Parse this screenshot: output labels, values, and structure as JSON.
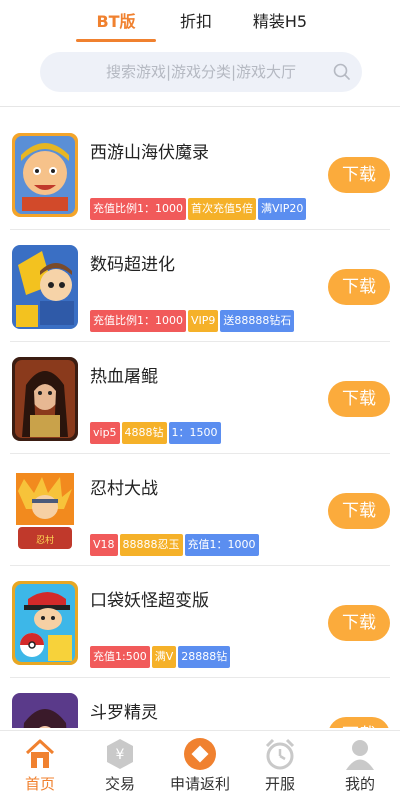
{
  "top_tabs": [
    {
      "label": "BT版",
      "active": true
    },
    {
      "label": "折扣",
      "active": false
    },
    {
      "label": "精装H5",
      "active": false
    }
  ],
  "search": {
    "placeholder": "搜索游戏|游戏分类|游戏大厅"
  },
  "colors": {
    "accent": "#f0812f",
    "download_button": "#fbab3c",
    "tag_red": "#f15a5a",
    "tag_orange": "#f5b129",
    "tag_blue": "#5b8ef0"
  },
  "games": [
    {
      "name": "西游山海伏魔录",
      "download_label": "下载",
      "tags": [
        {
          "text": "充值比例1：1000",
          "color": "red"
        },
        {
          "text": "首次充值5倍",
          "color": "orange"
        },
        {
          "text": "满VIP20",
          "color": "blue"
        }
      ]
    },
    {
      "name": "数码超进化",
      "download_label": "下载",
      "tags": [
        {
          "text": "充值比例1：1000",
          "color": "red"
        },
        {
          "text": "VIP9",
          "color": "orange"
        },
        {
          "text": "送88888钻石",
          "color": "blue"
        }
      ]
    },
    {
      "name": "热血屠鲲",
      "download_label": "下载",
      "tags": [
        {
          "text": "vip5",
          "color": "red"
        },
        {
          "text": "4888钻",
          "color": "orange"
        },
        {
          "text": "1：1500",
          "color": "blue"
        }
      ]
    },
    {
      "name": "忍村大战",
      "download_label": "下载",
      "tags": [
        {
          "text": "V18",
          "color": "red"
        },
        {
          "text": "88888忍玉",
          "color": "orange"
        },
        {
          "text": "充值1：1000",
          "color": "blue"
        }
      ]
    },
    {
      "name": "口袋妖怪超变版",
      "download_label": "下载",
      "tags": [
        {
          "text": "充值1:500",
          "color": "red"
        },
        {
          "text": "满V",
          "color": "orange"
        },
        {
          "text": "28888钻",
          "color": "blue"
        }
      ]
    },
    {
      "name": "斗罗精灵",
      "download_label": "下载",
      "tags": []
    }
  ],
  "bottom_nav": [
    {
      "label": "首页",
      "icon": "home-icon",
      "active": true
    },
    {
      "label": "交易",
      "icon": "trade-icon",
      "active": false
    },
    {
      "label": "申请返利",
      "icon": "rebate-icon",
      "active": false
    },
    {
      "label": "开服",
      "icon": "alarm-clock-icon",
      "active": false
    },
    {
      "label": "我的",
      "icon": "user-icon",
      "active": false
    }
  ]
}
